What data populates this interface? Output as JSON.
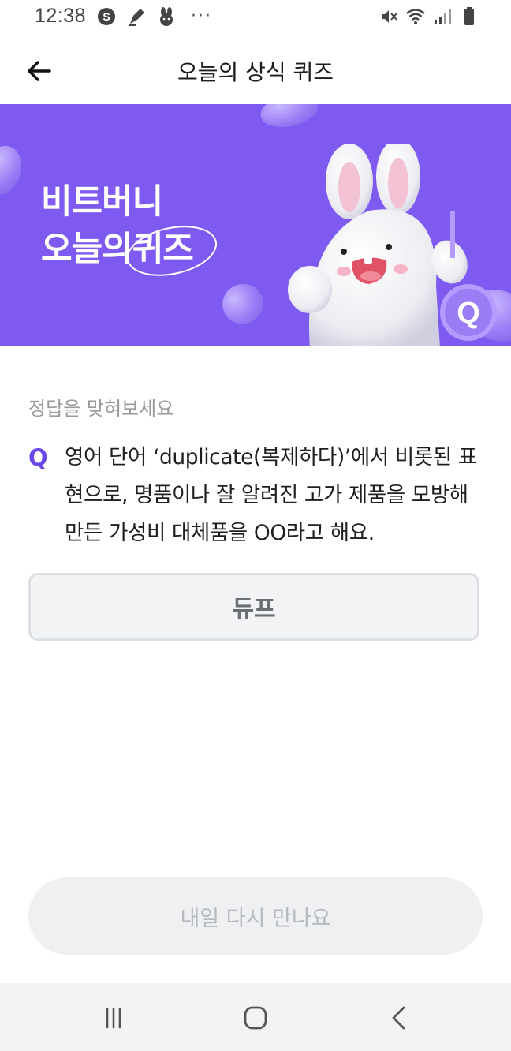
{
  "status_bar": {
    "time": "12:38",
    "more": "···",
    "icons": [
      "samsung-pay-icon",
      "pen-icon",
      "bunny-icon",
      "mute-icon",
      "wifi-icon",
      "signal-icon",
      "battery-icon"
    ]
  },
  "app_bar": {
    "title": "오늘의 상식 퀴즈",
    "back_icon": "arrow-left-icon"
  },
  "banner": {
    "line1": "비트버니",
    "line2_prefix": "오늘의",
    "line2_highlight": "퀴즈",
    "badge_letter": "Q",
    "background_color": "#7f5af0"
  },
  "quiz": {
    "hint": "정답을 맞혀보세요",
    "q_label": "Q",
    "question": "영어 단어 ‘duplicate(복제하다)’에서 비롯된 표현으로, 명품이나 잘 알려진 고가 제품을 모방해 만든 가성비 대체품을 OO라고 해요.",
    "answer": "듀프"
  },
  "footer": {
    "button_label": "내일 다시 만나요"
  },
  "nav_bar": {
    "icons": [
      "recent-apps-icon",
      "home-icon",
      "back-nav-icon"
    ]
  },
  "colors": {
    "accent": "#6c47e8",
    "banner": "#7f5af0"
  }
}
